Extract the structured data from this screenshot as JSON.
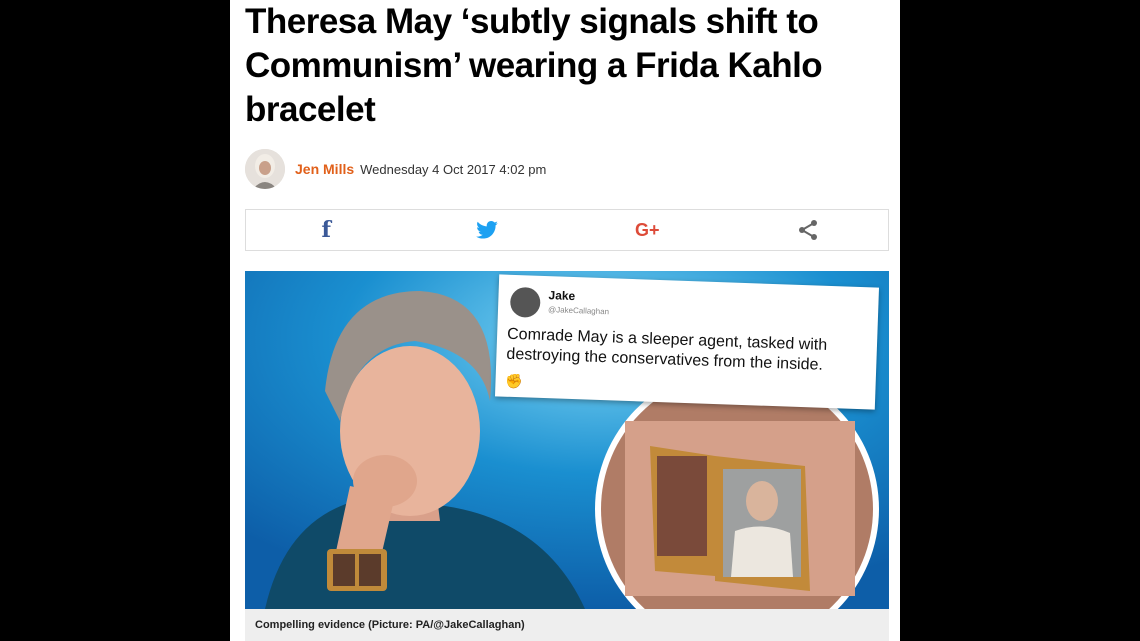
{
  "article": {
    "headline": "Theresa May ‘subtly signals shift to Communism’ wearing a Frida Kahlo bracelet",
    "author": "Jen Mills",
    "date": "Wednesday 4 Oct 2017 4:02 pm"
  },
  "share": {
    "facebook": "f",
    "twitter_icon": "twitter-bird-icon",
    "googleplus": "G+",
    "share_icon": "share-icon"
  },
  "tweet": {
    "name": "Jake",
    "handle": "@JakeCallaghan",
    "text": "Comrade May is a sleeper agent, tasked with destroying the conservatives from the inside.",
    "emoji": "✊"
  },
  "caption": "Compelling evidence (Picture: PA/@JakeCallaghan)",
  "colors": {
    "author": "#e1601a",
    "facebook": "#3b5998",
    "twitter": "#1da1f2",
    "googleplus": "#dd4b39",
    "photo_bg": "#1a8fd0"
  }
}
